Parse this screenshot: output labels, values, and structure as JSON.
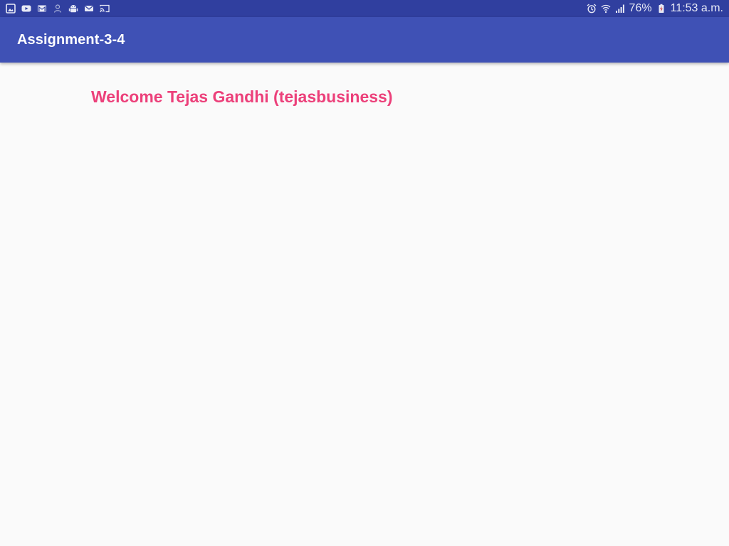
{
  "status_bar": {
    "left_icons": [
      "gallery-icon",
      "youtube-icon",
      "gmail-icon",
      "person-icon",
      "android-debug-icon",
      "email-icon",
      "cast-icon"
    ],
    "right_icons": [
      "alarm-icon",
      "wifi-icon",
      "signal-icon",
      "battery-icon"
    ],
    "battery_percent": "76%",
    "time": "11:53 a.m."
  },
  "app_bar": {
    "title": "Assignment-3-4"
  },
  "content": {
    "welcome_text": "Welcome Tejas Gandhi (tejasbusiness)"
  },
  "colors": {
    "status_bar": "#303f9f",
    "app_bar": "#3f51b5",
    "accent_text": "#ec407a",
    "background": "#fafafa"
  }
}
